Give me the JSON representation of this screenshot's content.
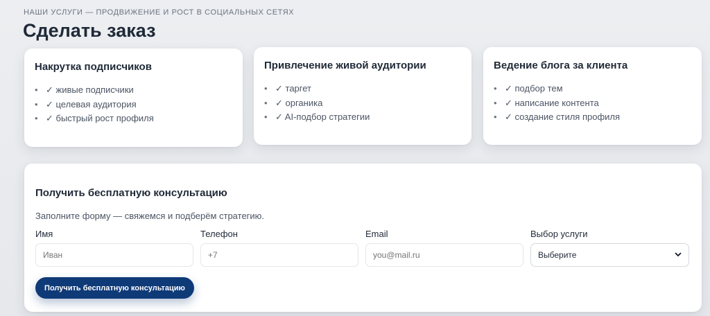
{
  "header": {
    "eyebrow": "НАШИ УСЛУГИ — ПРОДВИЖЕНИЕ И РОСТ В СОЦИАЛЬНЫХ СЕТЯХ",
    "title": "Сделать заказ"
  },
  "services": [
    {
      "title": "Накрутка подписчиков",
      "items": [
        "✓ живые подписчики",
        "✓ целевая аудитория",
        "✓ быстрый рост профиля"
      ]
    },
    {
      "title": "Привлечение живой аудитории",
      "items": [
        "✓ таргет",
        "✓ органика",
        "✓ AI-подбор стратегии"
      ]
    },
    {
      "title": "Ведение блога за клиента",
      "items": [
        "✓ подбор тем",
        "✓ написание контента",
        "✓ создание стиля профиля"
      ]
    }
  ],
  "form": {
    "title": "Получить бесплатную консультацию",
    "subtitle": "Заполните форму — свяжемся и подберём стратегию.",
    "fields": [
      {
        "label": "Имя",
        "placeholder": "Иван",
        "value": ""
      },
      {
        "label": "Телефон",
        "placeholder": "+7",
        "value": ""
      },
      {
        "label": "Email",
        "placeholder": "you@mail.ru",
        "value": ""
      },
      {
        "label": "Выбор услуги",
        "selected": "Выберите"
      }
    ],
    "submit_label": "Получить бесплатную консультацию"
  },
  "icons": {
    "bullet": "•",
    "chevron": "chevron-down-icon"
  },
  "colors": {
    "accent": "#0f3a78",
    "background": "#e9ebee"
  }
}
